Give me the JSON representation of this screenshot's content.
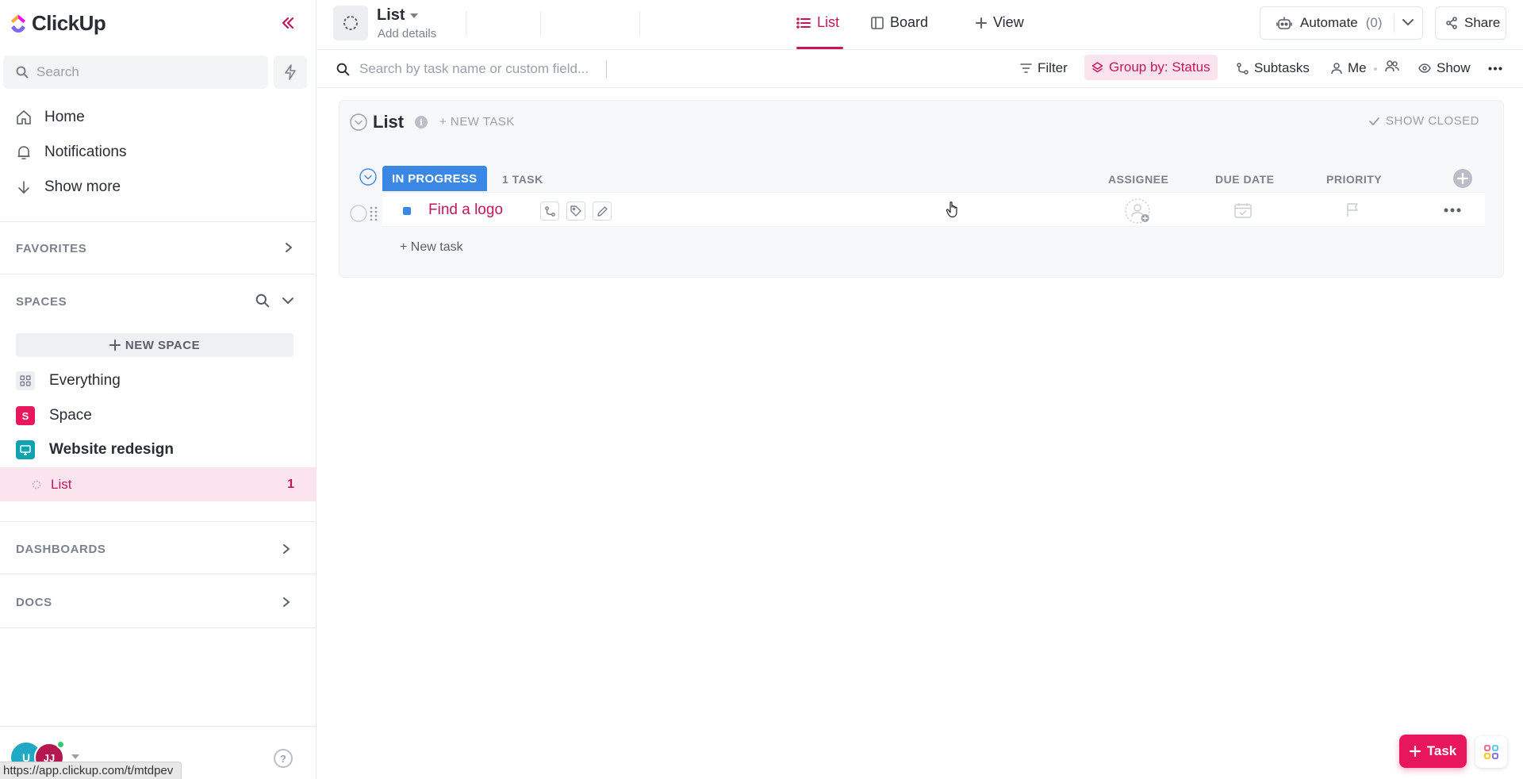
{
  "brand": {
    "name": "ClickUp",
    "accent": "#c2185b",
    "fab_color": "#e8175d"
  },
  "sidebar": {
    "search_placeholder": "Search",
    "nav": [
      {
        "label": "Home",
        "icon": "home-icon"
      },
      {
        "label": "Notifications",
        "icon": "bell-icon"
      },
      {
        "label": "Show more",
        "icon": "arrow-down-icon"
      }
    ],
    "favorites_title": "FAVORITES",
    "spaces_title": "SPACES",
    "new_space_label": "NEW SPACE",
    "spaces": [
      {
        "label": "Everything",
        "icon": "grid-icon"
      },
      {
        "label": "Space",
        "badge": "S",
        "badge_color": "#e8175d"
      },
      {
        "label": "Website redesign",
        "icon": "monitor-icon",
        "badge_color": "#0fa3b1"
      }
    ],
    "active_list": {
      "label": "List",
      "count": "1"
    },
    "dashboards_title": "DASHBOARDS",
    "docs_title": "DOCS",
    "avatars": [
      "U",
      "JJ"
    ],
    "help_label": "?"
  },
  "status_url": "https://app.clickup.com/t/mtdpev",
  "header": {
    "title": "List",
    "subtitle": "Add details",
    "tabs": [
      {
        "label": "List",
        "active": true
      },
      {
        "label": "Board",
        "active": false
      }
    ],
    "add_view_label": "View",
    "automate_label": "Automate",
    "automate_count": "(0)",
    "share_label": "Share"
  },
  "toolbar": {
    "search_placeholder": "Search by task name or custom field...",
    "filter_label": "Filter",
    "group_by_label": "Group by: Status",
    "subtasks_label": "Subtasks",
    "me_label": "Me",
    "show_label": "Show"
  },
  "list": {
    "title": "List",
    "new_task_label": "+ NEW TASK",
    "show_closed_label": "SHOW CLOSED",
    "group": {
      "status": "IN PROGRESS",
      "status_color": "#3b87e6",
      "task_count": "1 TASK",
      "columns": [
        "ASSIGNEE",
        "DUE DATE",
        "PRIORITY"
      ]
    },
    "tasks": [
      {
        "name": "Find a logo"
      }
    ],
    "add_task_label": "+ New task"
  },
  "fab": {
    "task_label": "Task"
  }
}
